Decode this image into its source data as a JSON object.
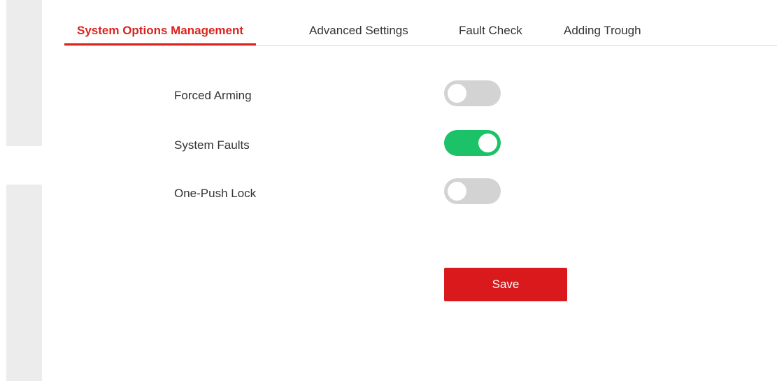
{
  "tabs": [
    {
      "label": "System Options Management",
      "active": true
    },
    {
      "label": "Advanced Settings",
      "active": false
    },
    {
      "label": "Fault Check",
      "active": false
    },
    {
      "label": "Adding Trough",
      "active": false
    }
  ],
  "options": [
    {
      "label": "Forced Arming",
      "enabled": false
    },
    {
      "label": "System Faults",
      "enabled": true
    },
    {
      "label": "One-Push Lock",
      "enabled": false
    }
  ],
  "save_label": "Save",
  "colors": {
    "accent": "#d9241e",
    "toggle_on": "#1bc267",
    "toggle_off": "#d3d3d3",
    "save_button": "#d9191c"
  }
}
